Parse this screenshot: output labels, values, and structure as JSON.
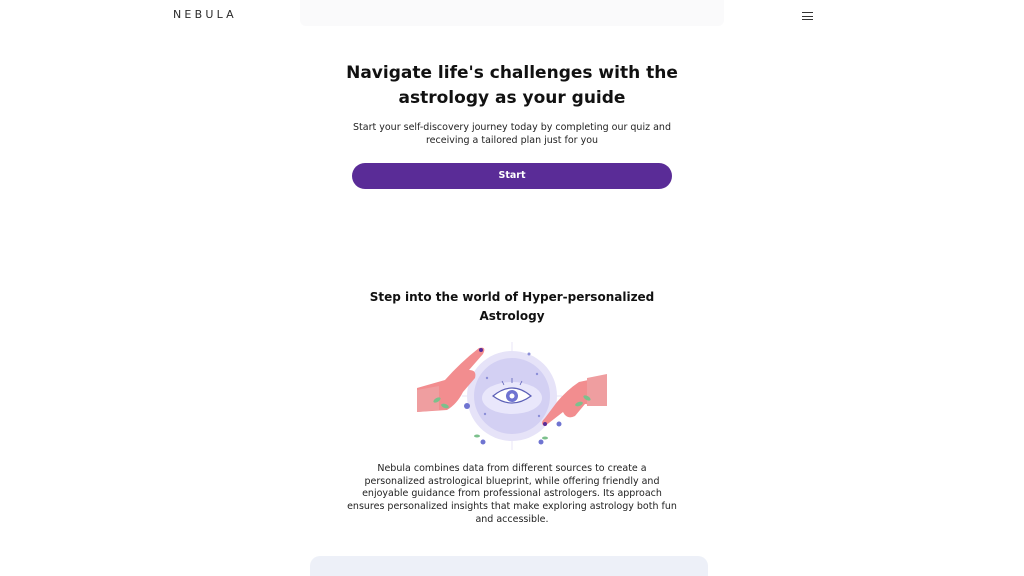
{
  "header": {
    "logo_text": "NEBULA",
    "menu_icon": "hamburger-menu-icon"
  },
  "hero": {
    "title": "Navigate life's challenges with the astrology as your guide",
    "subtitle": "Start your self-discovery journey today by completing our quiz and receiving a tailored plan just for you",
    "start_label": "Start"
  },
  "section": {
    "title": "Step into the world of Hyper-personalized Astrology",
    "illustration": "hands-crystal-ball-illustration",
    "description": "Nebula combines data from different sources to create a personalized astrological blueprint, while offering friendly and enjoyable guidance from professional astrologers. Its approach ensures personalized insights that make exploring astrology both fun and accessible."
  },
  "colors": {
    "primary_button": "#5a2c97",
    "card_background": "#edf0f8",
    "hand_pink": "#f28d8f",
    "sphere_lavender": "#c9c6ef"
  }
}
